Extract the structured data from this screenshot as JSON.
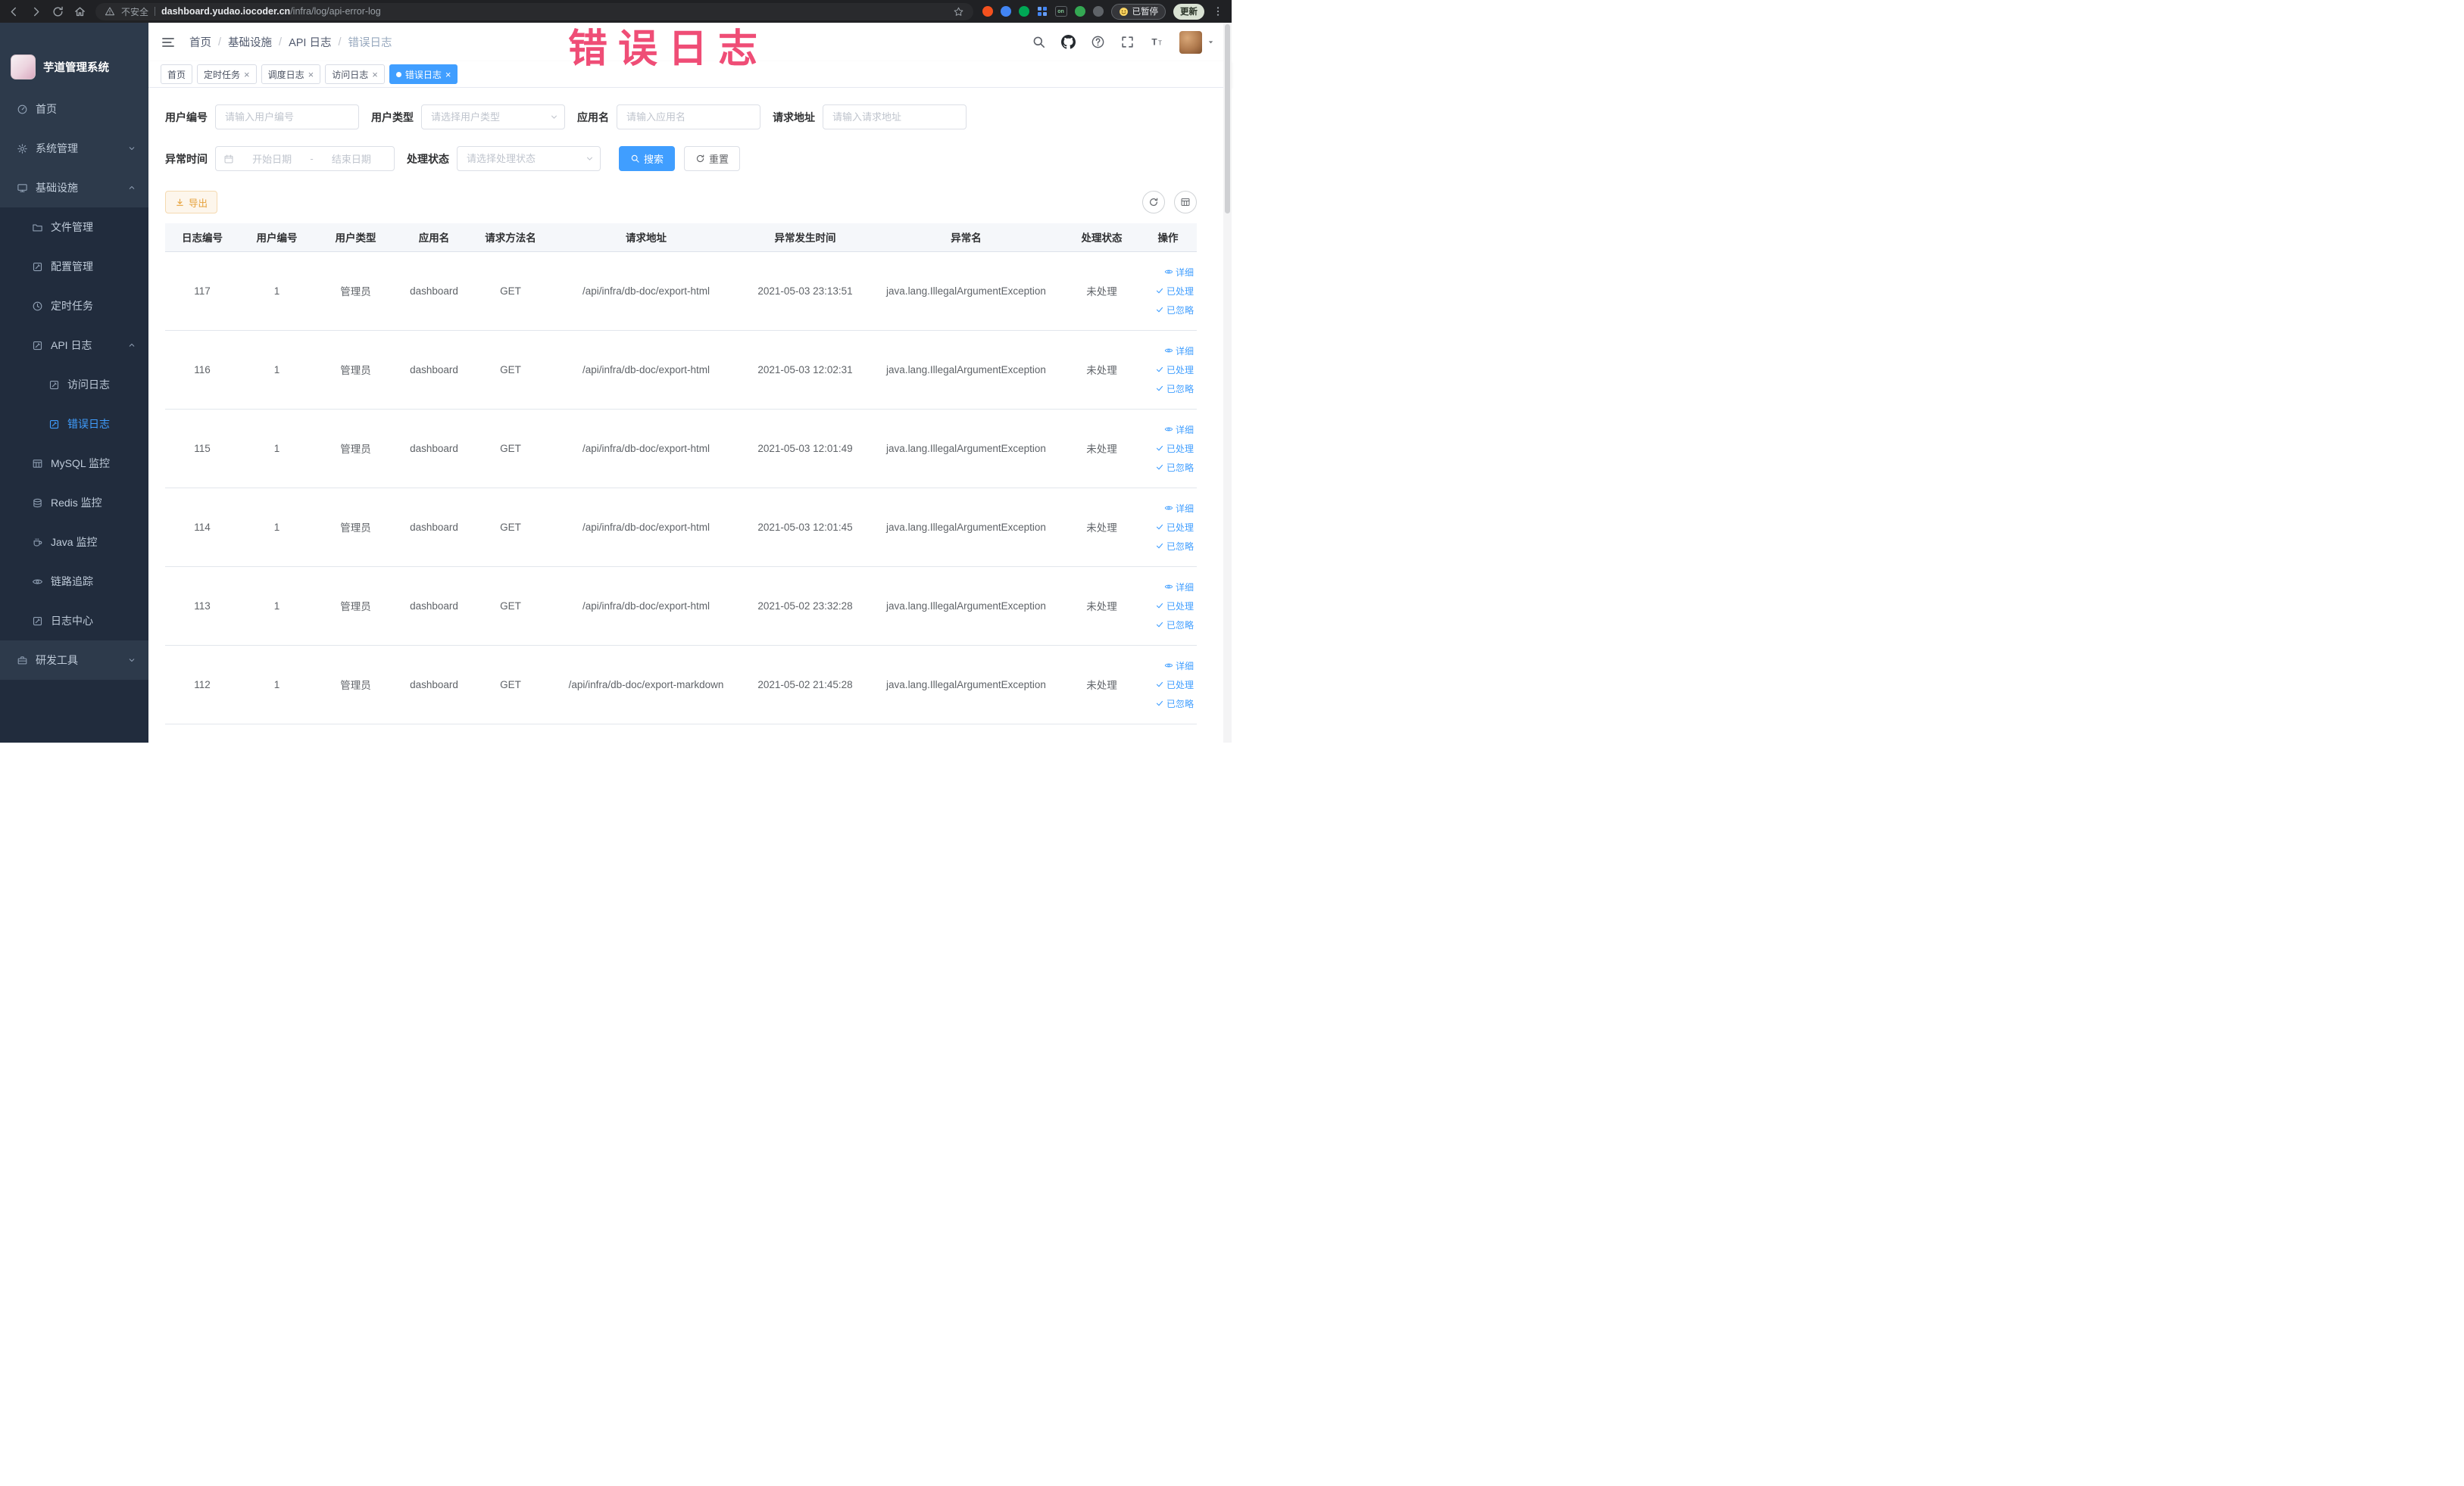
{
  "colors": {
    "accent": "#409eff",
    "warning": "#e6a23c",
    "sidebar_bg": "#2d3a4b",
    "annotation": "#ee3e6b"
  },
  "annotation": {
    "text": "错误日志"
  },
  "browser": {
    "security_label": "不安全",
    "url_domain": "dashboard.yudao.iocoder.cn",
    "url_path": "/infra/log/api-error-log",
    "extension_on_badge": "on",
    "paused_badge": "已暂停",
    "update_button": "更新"
  },
  "sidebar": {
    "logo_title": "芋道管理系统",
    "items": [
      {
        "label": "首页"
      },
      {
        "label": "系统管理"
      },
      {
        "label": "基础设施"
      },
      {
        "label": "文件管理"
      },
      {
        "label": "配置管理"
      },
      {
        "label": "定时任务"
      },
      {
        "label": "API 日志"
      },
      {
        "label": "访问日志"
      },
      {
        "label": "错误日志"
      },
      {
        "label": "MySQL 监控"
      },
      {
        "label": "Redis 监控"
      },
      {
        "label": "Java 监控"
      },
      {
        "label": "链路追踪"
      },
      {
        "label": "日志中心"
      },
      {
        "label": "研发工具"
      }
    ]
  },
  "topbar": {
    "breadcrumb": [
      "首页",
      "基础设施",
      "API 日志",
      "错误日志"
    ],
    "breadcrumb_separator": "/"
  },
  "tabs": [
    {
      "label": "首页"
    },
    {
      "label": "定时任务"
    },
    {
      "label": "调度日志"
    },
    {
      "label": "访问日志"
    },
    {
      "label": "错误日志"
    }
  ],
  "filters": {
    "user_id_label": "用户编号",
    "user_id_placeholder": "请输入用户编号",
    "user_type_label": "用户类型",
    "user_type_placeholder": "请选择用户类型",
    "app_name_label": "应用名",
    "app_name_placeholder": "请输入应用名",
    "request_url_label": "请求地址",
    "request_url_placeholder": "请输入请求地址",
    "exception_time_label": "异常时间",
    "date_start_placeholder": "开始日期",
    "date_separator": "-",
    "date_end_placeholder": "结束日期",
    "process_status_label": "处理状态",
    "process_status_placeholder": "请选择处理状态",
    "search_button": "搜索",
    "reset_button": "重置"
  },
  "toolbar": {
    "export_button": "导出"
  },
  "table": {
    "columns": [
      "日志编号",
      "用户编号",
      "用户类型",
      "应用名",
      "请求方法名",
      "请求地址",
      "异常发生时间",
      "异常名",
      "处理状态",
      "操作"
    ],
    "actions": [
      "详细",
      "已处理",
      "已忽略"
    ],
    "rows": [
      {
        "id": "117",
        "user_id": "1",
        "user_type": "管理员",
        "app_name": "dashboard",
        "method": "GET",
        "url": "/api/infra/db-doc/export-html",
        "time": "2021-05-03 23:13:51",
        "exception": "java.lang.IllegalArgumentException",
        "status": "未处理"
      },
      {
        "id": "116",
        "user_id": "1",
        "user_type": "管理员",
        "app_name": "dashboard",
        "method": "GET",
        "url": "/api/infra/db-doc/export-html",
        "time": "2021-05-03 12:02:31",
        "exception": "java.lang.IllegalArgumentException",
        "status": "未处理"
      },
      {
        "id": "115",
        "user_id": "1",
        "user_type": "管理员",
        "app_name": "dashboard",
        "method": "GET",
        "url": "/api/infra/db-doc/export-html",
        "time": "2021-05-03 12:01:49",
        "exception": "java.lang.IllegalArgumentException",
        "status": "未处理"
      },
      {
        "id": "114",
        "user_id": "1",
        "user_type": "管理员",
        "app_name": "dashboard",
        "method": "GET",
        "url": "/api/infra/db-doc/export-html",
        "time": "2021-05-03 12:01:45",
        "exception": "java.lang.IllegalArgumentException",
        "status": "未处理"
      },
      {
        "id": "113",
        "user_id": "1",
        "user_type": "管理员",
        "app_name": "dashboard",
        "method": "GET",
        "url": "/api/infra/db-doc/export-html",
        "time": "2021-05-02 23:32:28",
        "exception": "java.lang.IllegalArgumentException",
        "status": "未处理"
      },
      {
        "id": "112",
        "user_id": "1",
        "user_type": "管理员",
        "app_name": "dashboard",
        "method": "GET",
        "url": "/api/infra/db-doc/export-markdown",
        "time": "2021-05-02 21:45:28",
        "exception": "java.lang.IllegalArgumentException",
        "status": "未处理"
      }
    ]
  }
}
